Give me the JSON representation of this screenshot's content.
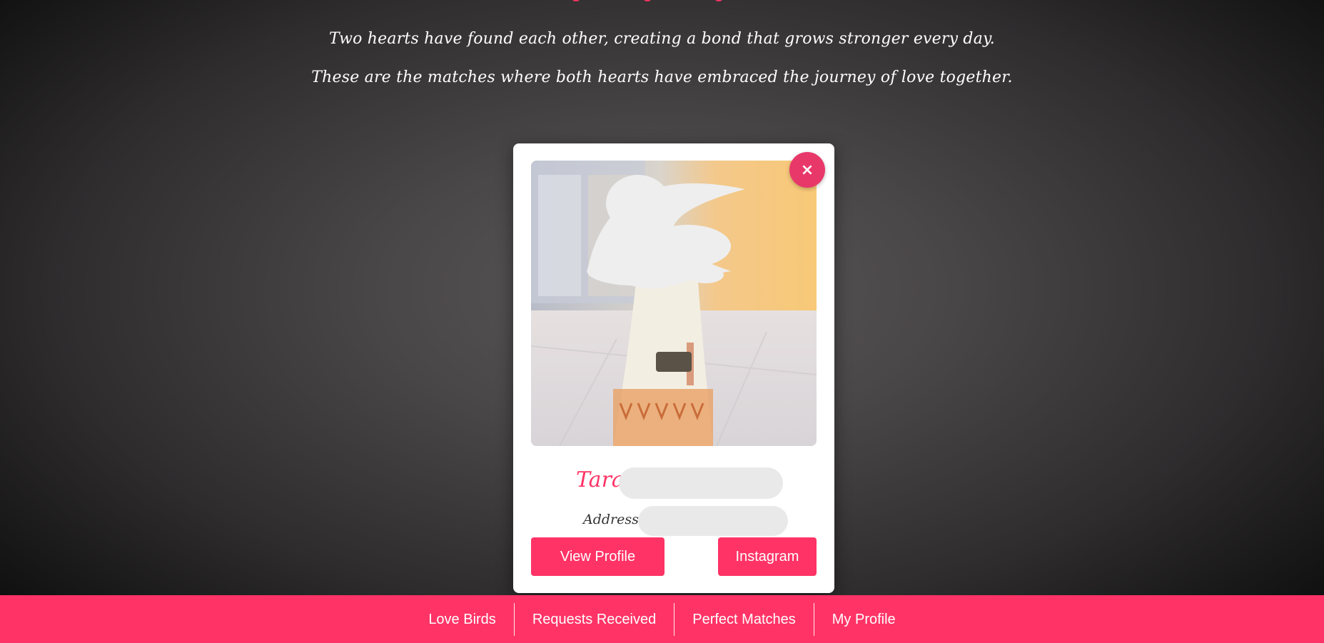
{
  "intro": {
    "line1": "Two hearts have found each other, creating a bond that grows stronger every day.",
    "line2": "These are the matches where both hearts have embraced the journey of love together."
  },
  "match_card": {
    "close_label": "×",
    "name": "Tara",
    "address_label": "Address: N",
    "view_profile_label": "View Profile",
    "instagram_label": "Instagram"
  },
  "bottom_nav": {
    "items": [
      {
        "label": "Love Birds"
      },
      {
        "label": "Requests Received"
      },
      {
        "label": "Perfect Matches"
      },
      {
        "label": "My Profile"
      }
    ]
  },
  "colors": {
    "accent": "#ff3366",
    "close_button": "#e8386a",
    "card_bg": "#ffffff",
    "redaction": "#e9e9e9"
  },
  "icons": {
    "close": "close-icon",
    "photo": "profile-photo"
  }
}
